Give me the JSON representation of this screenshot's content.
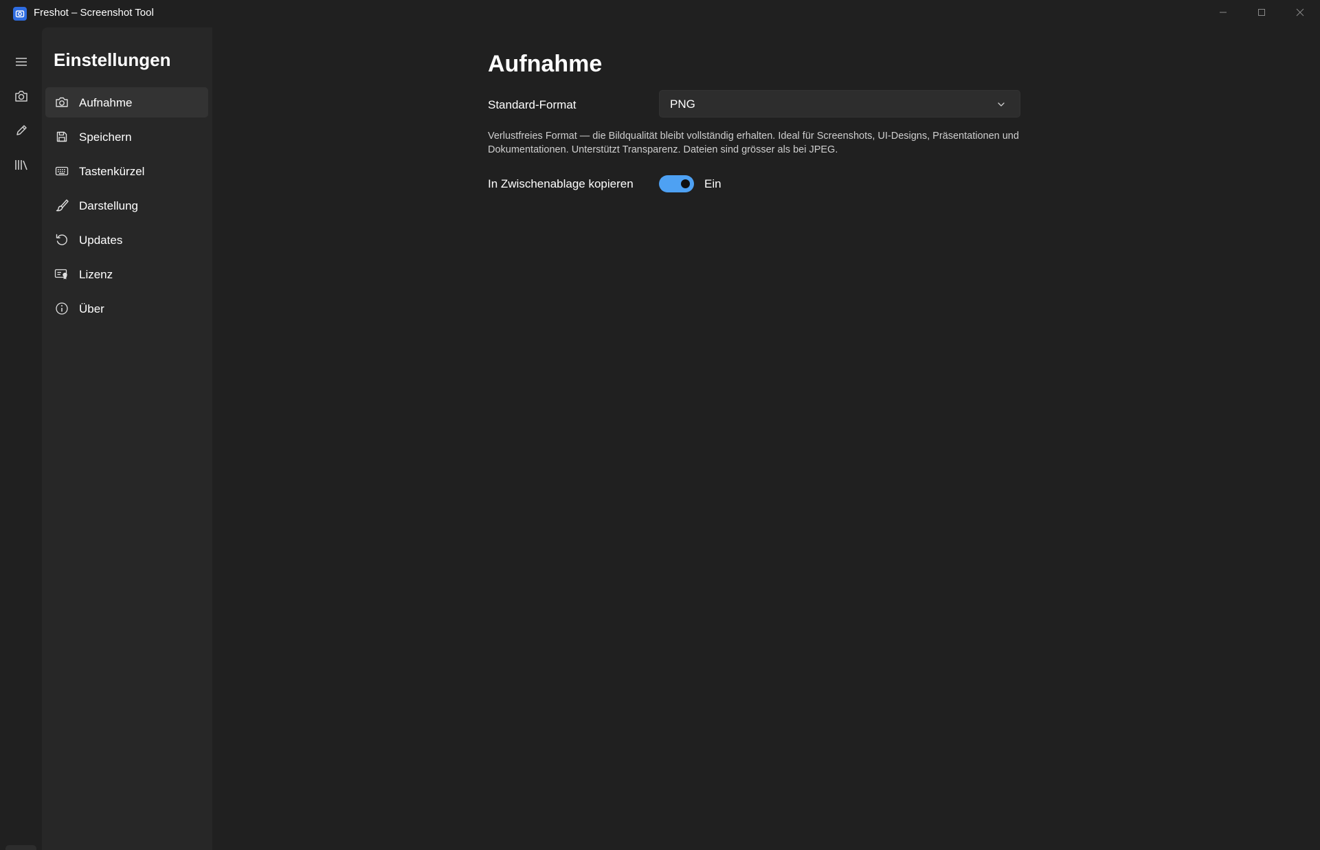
{
  "window": {
    "title": "Freshot – Screenshot Tool",
    "icon": "camera-app-icon",
    "controls": [
      "minimize-icon",
      "maximize-icon",
      "close-icon"
    ]
  },
  "rail": {
    "items": [
      {
        "name": "hamburger-menu",
        "icon": "hamburger-icon"
      },
      {
        "name": "capture",
        "icon": "camera-icon"
      },
      {
        "name": "edit",
        "icon": "pencil-icon"
      },
      {
        "name": "library",
        "icon": "library-icon"
      }
    ],
    "bottom": {
      "name": "settings",
      "icon": "gear-icon",
      "selected": true
    }
  },
  "settings_nav": {
    "heading": "Einstellungen",
    "items": [
      {
        "label": "Aufnahme",
        "icon": "camera-icon",
        "active": true
      },
      {
        "label": "Speichern",
        "icon": "save-icon",
        "active": false
      },
      {
        "label": "Tastenkürzel",
        "icon": "keyboard-icon",
        "active": false
      },
      {
        "label": "Darstellung",
        "icon": "brush-icon",
        "active": false
      },
      {
        "label": "Updates",
        "icon": "refresh-icon",
        "active": false
      },
      {
        "label": "Lizenz",
        "icon": "license-icon",
        "active": false
      },
      {
        "label": "Über",
        "icon": "info-icon",
        "active": false
      }
    ]
  },
  "main": {
    "title": "Aufnahme",
    "format": {
      "label": "Standard-Format",
      "value": "PNG",
      "description": "Verlustfreies Format — die Bildqualität bleibt vollständig erhalten. Ideal für Screenshots, UI-Designs, Präsentationen und Dokumentationen. Unterstützt Transparenz. Dateien sind grösser als bei JPEG."
    },
    "clipboard": {
      "label": "In Zwischenablage kopieren",
      "enabled": true,
      "state_label": "Ein"
    }
  },
  "colors": {
    "accent": "#4ea1f3",
    "background": "#202020",
    "panel": "#272727",
    "active_item": "#333333"
  }
}
